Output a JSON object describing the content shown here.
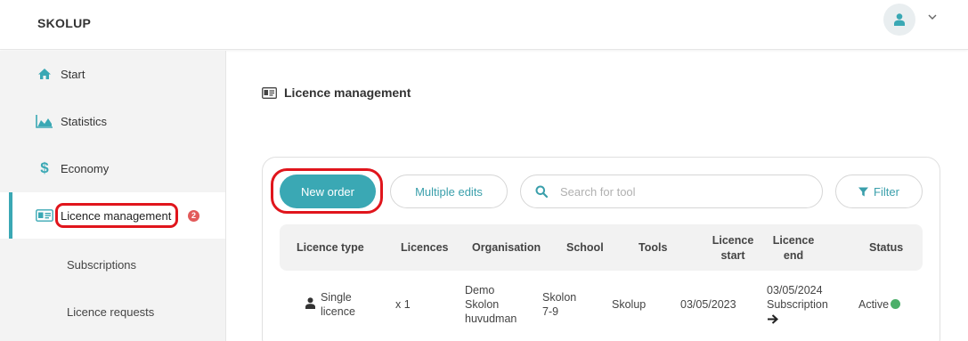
{
  "header": {
    "brand": "SKOLUP",
    "user_icon": "user-icon",
    "menu_icon": "chevron-down-icon"
  },
  "sidebar": {
    "items": [
      {
        "label": "Start",
        "icon": "home-icon"
      },
      {
        "label": "Statistics",
        "icon": "area-chart-icon"
      },
      {
        "label": "Economy",
        "icon": "dollar-icon"
      },
      {
        "label": "Licence management",
        "icon": "id-card-icon",
        "badge": "2",
        "active": true
      }
    ],
    "sub_items": [
      {
        "label": "Subscriptions"
      },
      {
        "label": "Licence requests"
      }
    ]
  },
  "main": {
    "title": "Licence management",
    "toolbar": {
      "new_order": "New order",
      "multiple_edits": "Multiple edits",
      "search_placeholder": "Search for tool",
      "filter": "Filter"
    },
    "table": {
      "columns": [
        "Licence type",
        "Licences",
        "Organisation",
        "School",
        "Tools",
        "Licence start",
        "Licence end",
        "Status"
      ],
      "rows": [
        {
          "licence_type": "Single licence",
          "licences": "x 1",
          "organisation": "Demo Skolon huvudman",
          "school": "Skolon 7-9",
          "tools": "Skolup",
          "licence_start": "03/05/2023",
          "licence_end": "03/05/2024",
          "licence_end_sub": "Subscription",
          "status": "Active"
        }
      ]
    }
  },
  "colors": {
    "accent": "#3aa8b4",
    "highlight": "#e0151c",
    "badge": "#e25a5a",
    "active_status": "#4caf6a"
  }
}
